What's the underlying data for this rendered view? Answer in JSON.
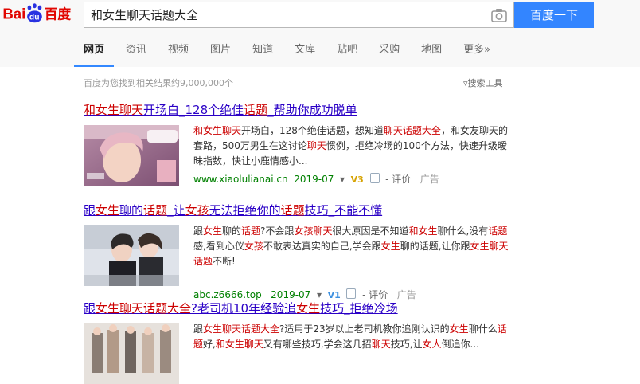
{
  "header": {
    "logo_letters": "Bai",
    "logo_du": "du",
    "logo_cn": "百度",
    "search_value": "和女生聊天话题大全",
    "search_button": "百度一下"
  },
  "tabs": [
    {
      "label": "网页",
      "active": true
    },
    {
      "label": "资讯"
    },
    {
      "label": "视频"
    },
    {
      "label": "图片"
    },
    {
      "label": "知道"
    },
    {
      "label": "文库"
    },
    {
      "label": "贴吧"
    },
    {
      "label": "采购"
    },
    {
      "label": "地图"
    },
    {
      "label": "更多»"
    }
  ],
  "result_count": "百度为您找到相关结果约9,000,000个",
  "tools_label": "搜索工具",
  "results": [
    {
      "title_html": "<em>和女生聊天</em>开场白_128个绝佳<em>话题</em>_帮助你成功脱单",
      "abstract_html": "<em>和女生聊天</em>开场白，128个绝佳话题，想知道<em>聊天话题大全</em>，和女友聊天的套路，500万男生在这讨论<em>聊天</em>惯例，拒绝冷场的100个方法，快速升级暧昧指数，快让小鹿情感小...",
      "url": "www.xiaolulianai.cn",
      "date": "2019-07",
      "vlevel": "V3",
      "comment": "评价",
      "ad": "广告"
    },
    {
      "title_html": "跟<em>女生</em>聊的<em>话题</em>_让<em>女孩</em>无法拒绝你的<em>话题</em>技巧_不能不懂",
      "abstract_html": "跟<em>女生</em>聊的<em>话题</em>?不会跟<em>女孩聊天</em>很大原因是不知道<em>和女生</em>聊什么,没有<em>话题</em>感,看到心仪<em>女孩</em>不敢表达真实的自己,学会跟<em>女生</em>聊的话题,让你跟<em>女生聊天话题</em>不断!",
      "url": "abc.z6666.top",
      "date": "2019-07",
      "vlevel": "V1",
      "comment": "评价",
      "ad": "广告"
    },
    {
      "title_html": "跟<em>女生聊天话题大全</em>?老司机10年经验追<em>女生</em>技巧_拒绝冷场",
      "abstract_html": "跟<em>女生聊天话题大全</em>?适用于23岁以上老司机教你追刚认识的<em>女生</em>聊什么<em>话题</em>好,<em>和女生聊天</em>又有哪些技巧,学会这几招<em>聊天</em>技巧,让<em>女人</em>倒追你..."
    }
  ],
  "colors": {
    "accent": "#3385ff",
    "link": "#2a00c6",
    "highlight": "#cc0000",
    "url_green": "#008000"
  }
}
